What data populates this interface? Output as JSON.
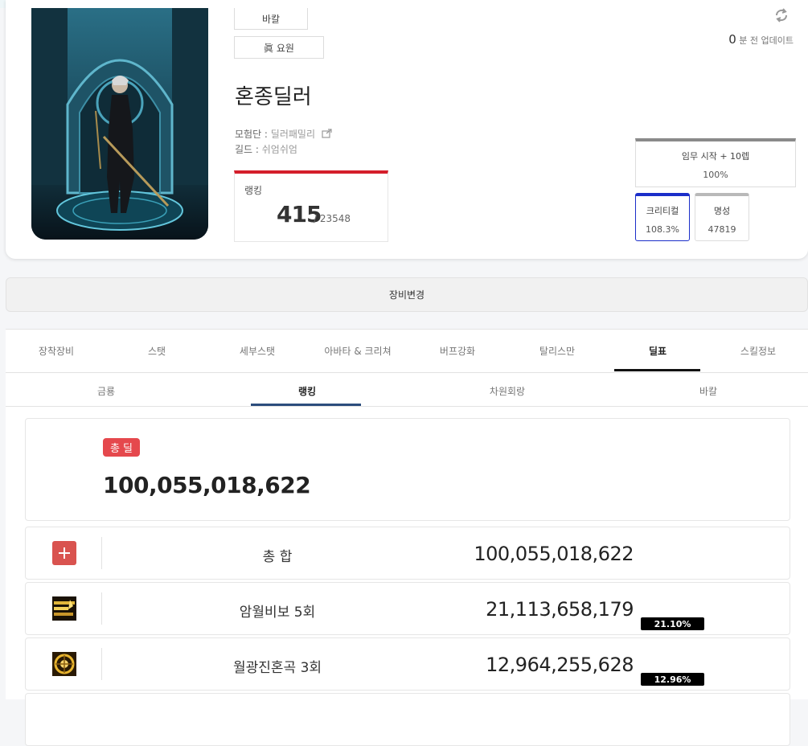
{
  "profile": {
    "server": "바칼",
    "class_name": "眞 요원",
    "character_name": "혼종딜러",
    "adventure_label": "모험단 : ",
    "adventure_value": "딜러패밀리",
    "guild_label": "길드 : ",
    "guild_value": "쉬엄쉬엄",
    "rank_label": "랭킹",
    "rank_value": "415",
    "rank_total": "/ 23548",
    "update_number": "0",
    "update_text": "분 전 업데이트"
  },
  "stats": {
    "mission_title": "임무 시작 + 10렙",
    "mission_value": "100%",
    "critical_title": "크리티컬",
    "critical_value": "108.3%",
    "fame_title": "명성",
    "fame_value": "47819"
  },
  "change_equipment_label": "장비변경",
  "tabs": [
    {
      "label": "장착장비"
    },
    {
      "label": "스탯"
    },
    {
      "label": "세부스탯"
    },
    {
      "label": "아바타 & 크리쳐"
    },
    {
      "label": "버프강화"
    },
    {
      "label": "탈리스만"
    },
    {
      "label": "딜표"
    },
    {
      "label": "스킬정보"
    }
  ],
  "subtabs": [
    {
      "label": "금룡"
    },
    {
      "label": "랭킹"
    },
    {
      "label": "차원회랑"
    },
    {
      "label": "바칼"
    }
  ],
  "total_damage": {
    "badge": "총 딜",
    "value": "100,055,018,622"
  },
  "skill_rows": [
    {
      "name": "총 합",
      "value": "100,055,018,622",
      "percent": ""
    },
    {
      "name": "암월비보 5회",
      "value": "21,113,658,179",
      "percent": "21.10%"
    },
    {
      "name": "월광진혼곡 3회",
      "value": "12,964,255,628",
      "percent": "12.96%"
    }
  ],
  "colors": {
    "rank_accent": "#d41e2b",
    "badge_red": "#e5484d",
    "critical_border": "#1b2ec9",
    "subtab_underline": "#2c4d7c"
  }
}
